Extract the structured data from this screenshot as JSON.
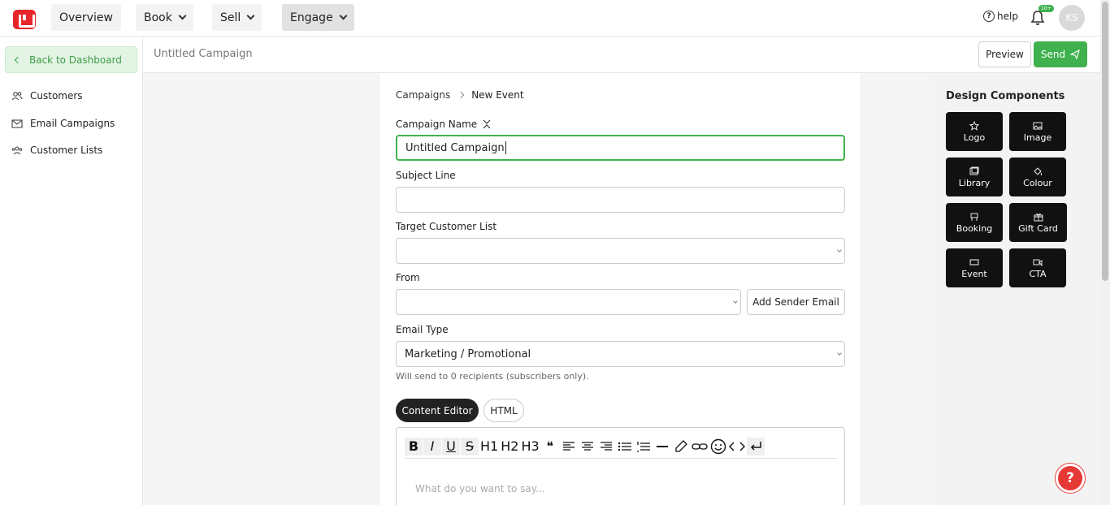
{
  "nav": {
    "items": [
      {
        "label": "Overview",
        "has_dropdown": false
      },
      {
        "label": "Book",
        "has_dropdown": true
      },
      {
        "label": "Sell",
        "has_dropdown": true
      },
      {
        "label": "Engage",
        "has_dropdown": true,
        "active": true
      }
    ],
    "help_label": "help",
    "notification_count": "10+",
    "avatar_initials": "KS"
  },
  "sidebar": {
    "back_label": "Back to Dashboard",
    "items": [
      {
        "label": "Customers",
        "icon": "users-icon"
      },
      {
        "label": "Email Campaigns",
        "icon": "mail-icon"
      },
      {
        "label": "Customer Lists",
        "icon": "user-group-icon"
      }
    ]
  },
  "titlebar": {
    "title": "Untitled Campaign",
    "preview_label": "Preview",
    "send_label": "Send"
  },
  "form": {
    "breadcrumb": {
      "parent": "Campaigns",
      "current": "New Event"
    },
    "campaign_name": {
      "label": "Campaign Name",
      "value": "Untitled Campaign"
    },
    "subject_line": {
      "label": "Subject Line",
      "value": ""
    },
    "target_list": {
      "label": "Target Customer List",
      "value": ""
    },
    "from": {
      "label": "From",
      "value": "",
      "add_sender_label": "Add Sender Email"
    },
    "email_type": {
      "label": "Email Type",
      "value": "Marketing / Promotional"
    },
    "recipients_note": "Will send to 0 recipients (subscribers only).",
    "tabs": {
      "editor": "Content Editor",
      "html": "HTML"
    },
    "editor": {
      "toolbar": [
        "B",
        "I",
        "U",
        "S",
        "H1",
        "H2",
        "H3",
        "quote",
        "align-left",
        "align-center",
        "align-right",
        "bullet-list",
        "numbered-list",
        "hr",
        "highlight",
        "link",
        "emoji",
        "code",
        "line-break"
      ],
      "placeholder": "What do you want to say..."
    }
  },
  "design_components": {
    "title": "Design Components",
    "items": [
      {
        "label": "Logo",
        "icon": "star-icon"
      },
      {
        "label": "Image",
        "icon": "image-icon"
      },
      {
        "label": "Library",
        "icon": "library-icon"
      },
      {
        "label": "Colour",
        "icon": "paint-bucket-icon"
      },
      {
        "label": "Booking",
        "icon": "booking-icon"
      },
      {
        "label": "Gift Card",
        "icon": "gift-icon"
      },
      {
        "label": "Event",
        "icon": "ticket-icon"
      },
      {
        "label": "CTA",
        "icon": "cta-icon"
      }
    ]
  },
  "help_fab": "?",
  "colors": {
    "accent": "#3fb14e",
    "brand": "#e8262a",
    "dark": "#111111"
  }
}
